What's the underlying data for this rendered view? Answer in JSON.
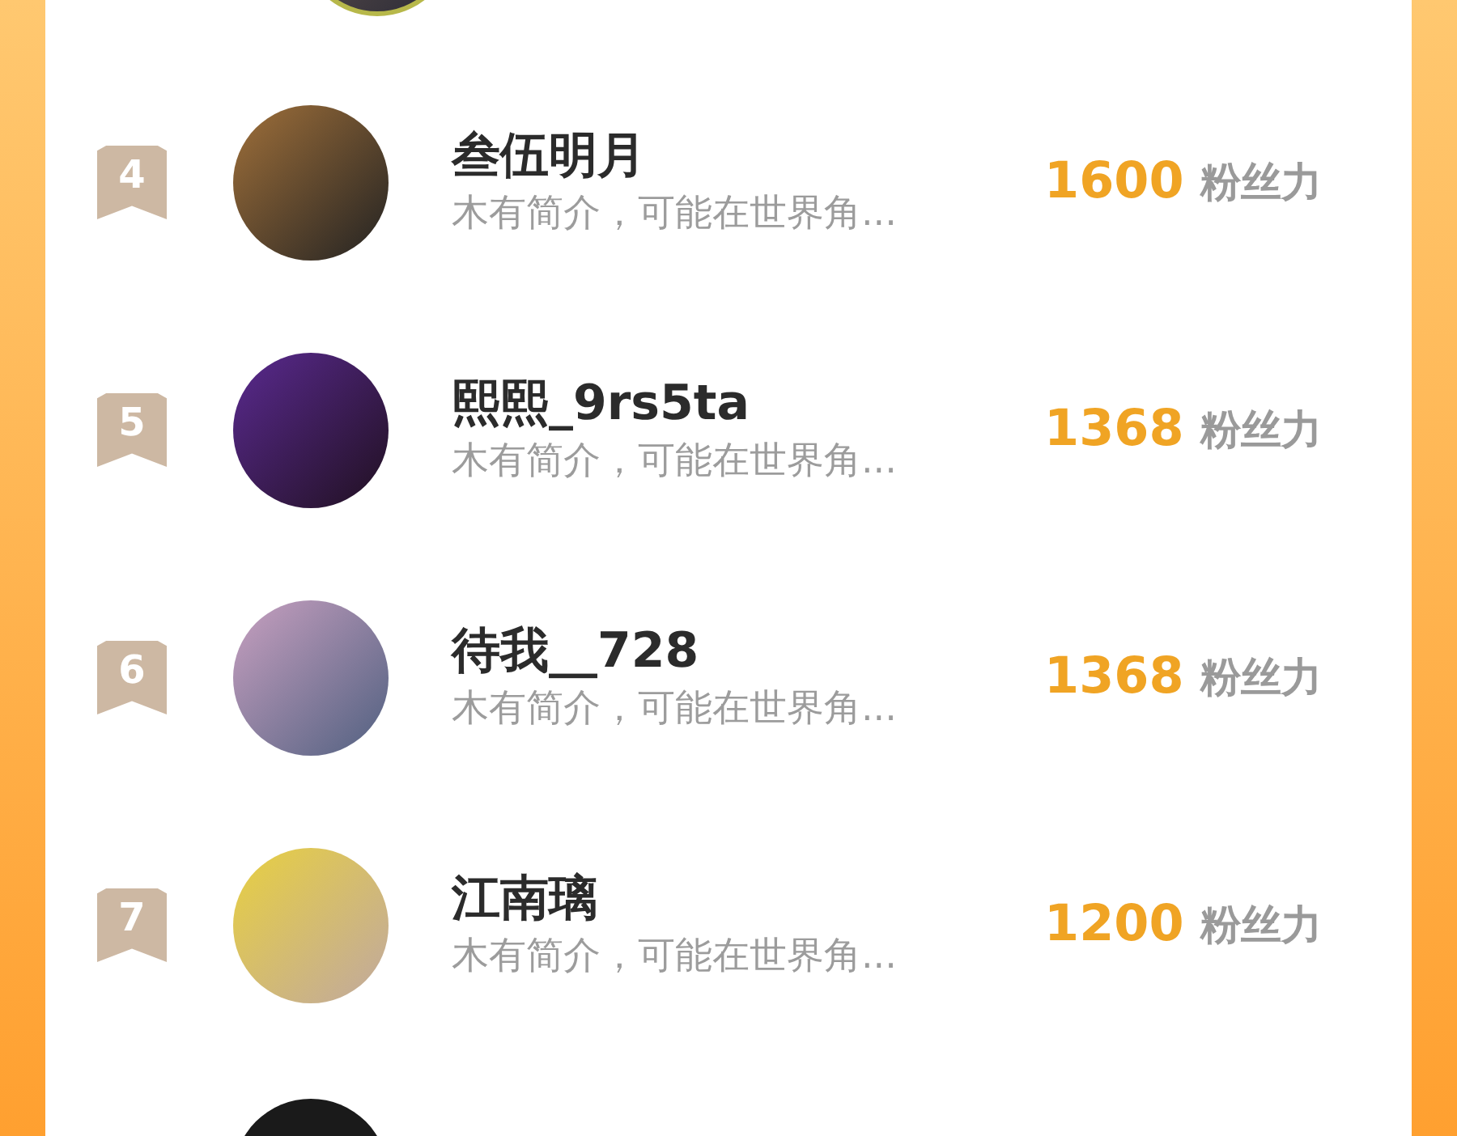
{
  "rankings": [
    {
      "rank": "4",
      "name": "叁伍明月",
      "bio": "木有简介，可能在世界角...",
      "score": "1600",
      "unit": "粉丝力"
    },
    {
      "rank": "5",
      "name": "熙熙_9rs5ta",
      "bio": "木有简介，可能在世界角...",
      "score": "1368",
      "unit": "粉丝力"
    },
    {
      "rank": "6",
      "name": "待我__728",
      "bio": "木有简介，可能在世界角...",
      "score": "1368",
      "unit": "粉丝力"
    },
    {
      "rank": "7",
      "name": "江南璃",
      "bio": "木有简介，可能在世界角...",
      "score": "1200",
      "unit": "粉丝力"
    }
  ]
}
